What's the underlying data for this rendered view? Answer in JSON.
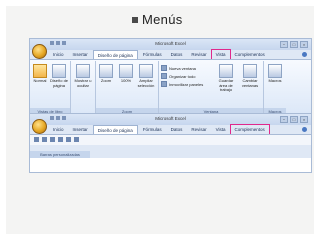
{
  "slide": {
    "title": "Menús"
  },
  "window": {
    "title": "Microsoft Excel",
    "controls": [
      "−",
      "□",
      "×"
    ]
  },
  "tabs": [
    "Inicio",
    "Insertar",
    "Diseño de página",
    "Fórmulas",
    "Datos",
    "Revisar",
    "Vista",
    "Complementos"
  ],
  "ribbon1": {
    "active_tab": "Diseño de página",
    "highlight_tab": "Vista",
    "groups": [
      "Vistas de libro",
      "Zoom",
      "Ventana",
      "Macros"
    ],
    "buttons": {
      "normal": "Normal",
      "page_layout": "Diseño de página",
      "show_hide": "Mostrar u ocultar",
      "zoom": "Zoom",
      "zoom100": "100%",
      "zoom_selection": "Ampliar selección",
      "new_window": "Nueva ventana",
      "arrange_all": "Organizar todo",
      "freeze_panes": "Inmovilizar paneles",
      "save_workspace": "Guardar área de trabajo",
      "switch_windows": "Cambiar ventanas",
      "macros": "Macros"
    }
  },
  "ribbon2": {
    "active_tab": "Diseño de página",
    "highlight_tab": "Complementos",
    "group_label": "Barras personalizadas"
  },
  "colors": {
    "highlight": "#e0288c",
    "ribbon": "#dfe8f5"
  }
}
